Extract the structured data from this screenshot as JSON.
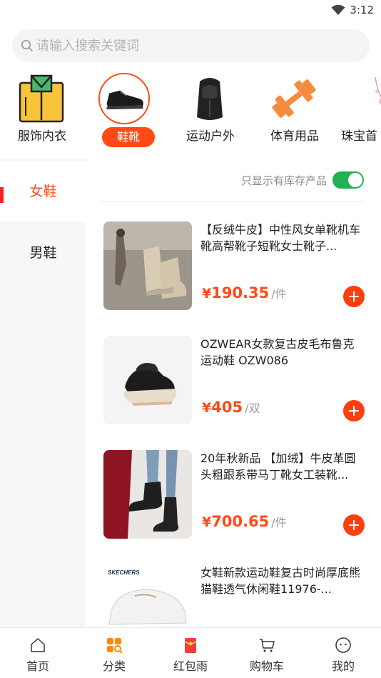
{
  "status_bar": {
    "time": "3:12",
    "wifi_icon": "wifi-icon"
  },
  "search": {
    "placeholder": "请输入搜索关键词",
    "value": "",
    "icon": "search-icon"
  },
  "categories": [
    {
      "label": "服饰内衣",
      "icon": "clothing-image",
      "active": false
    },
    {
      "label": "鞋靴",
      "icon": "shoe-image",
      "active": true
    },
    {
      "label": "运动户外",
      "icon": "backpack-image",
      "active": false
    },
    {
      "label": "体育用品",
      "icon": "dumbbell-image",
      "active": false
    },
    {
      "label": "珠宝首",
      "icon": "jewelry-image",
      "active": false
    }
  ],
  "sidebar": {
    "items": [
      {
        "label": "女鞋",
        "active": true
      },
      {
        "label": "男鞋",
        "active": false
      }
    ]
  },
  "stock_filter": {
    "label": "只显示有库存产品",
    "enabled": true
  },
  "products": [
    {
      "title": "【反绒牛皮】中性风女单靴机车靴高帮靴子短靴女士靴子...",
      "price_symbol": "¥",
      "price": "190.35",
      "unit": "/件",
      "image": "beige-boots-image"
    },
    {
      "title": "OZWEAR女款复古皮毛布鲁克运动鞋 OZW086",
      "price_symbol": "¥",
      "price": "405",
      "unit": "/双",
      "image": "black-fur-sneaker-image"
    },
    {
      "title": "20年秋新品 【加绒】牛皮革圆头粗跟系带马丁靴女工装靴...",
      "price_symbol": "¥",
      "price": "700.65",
      "unit": "/件",
      "image": "martin-boots-image"
    },
    {
      "title": "女鞋新款运动鞋复古时尚厚底熊猫鞋透气休闲鞋11976-...",
      "price_symbol": "¥",
      "price": "",
      "unit": "",
      "image": "skechers-sneaker-image"
    }
  ],
  "tabbar": {
    "items": [
      {
        "label": "首页",
        "icon": "home-icon"
      },
      {
        "label": "分类",
        "icon": "category-icon"
      },
      {
        "label": "红包雨",
        "icon": "red-envelope-icon"
      },
      {
        "label": "购物车",
        "icon": "cart-icon"
      },
      {
        "label": "我的",
        "icon": "profile-icon"
      }
    ]
  },
  "colors": {
    "accent": "#ff4a16",
    "toggle_on": "#1fb152",
    "tab_active": "#ff7a00"
  },
  "misc": {
    "skechers_brand_text": "SKECHERS"
  }
}
